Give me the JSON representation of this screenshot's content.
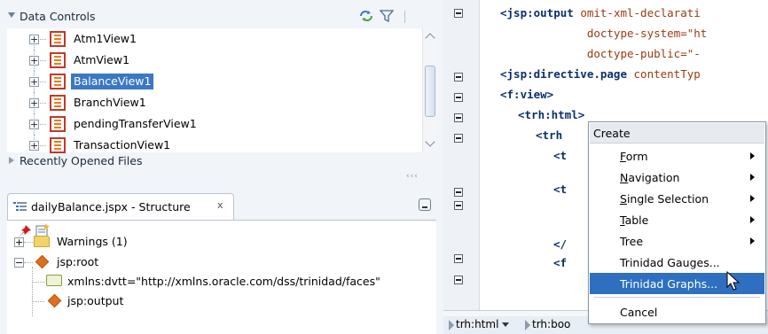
{
  "data_controls": {
    "title": "Data Controls",
    "items": [
      {
        "label": "Atm1View1"
      },
      {
        "label": "AtmView1"
      },
      {
        "label": "BalanceView1",
        "selected": true
      },
      {
        "label": "BranchView1"
      },
      {
        "label": "pendingTransferView1"
      },
      {
        "label": "TransactionView1"
      }
    ],
    "recently_opened": "Recently Opened Files"
  },
  "structure": {
    "tab_label": "dailyBalance.jspx - Structure",
    "close_glyph": "x",
    "nodes": [
      {
        "label": "Warnings (1)"
      },
      {
        "label": "jsp:root"
      },
      {
        "label": "xmlns:dvtt=\"http://xmlns.oracle.com/dss/trinidad/faces\""
      },
      {
        "label": "jsp:output"
      }
    ]
  },
  "editor": {
    "lines": [
      {
        "tag": "<jsp:output",
        "rest": " omit-xml-declarati"
      },
      {
        "tag": "",
        "rest": "             doctype-system=\"ht"
      },
      {
        "tag": "",
        "rest": "             doctype-public=\"-"
      },
      {
        "tag": "<jsp:directive.page",
        "rest": " contentTyp"
      },
      {
        "tag": "<f:view>",
        "rest": ""
      },
      {
        "tag": "<trh:html>",
        "rest": ""
      },
      {
        "tag": "<trh",
        "rest": ""
      },
      {
        "tag": "<t",
        "rest": ""
      },
      {
        "tag": "<t",
        "rest": ""
      },
      {
        "tag": "</",
        "rest": ""
      },
      {
        "tag": "<f",
        "rest": ""
      }
    ],
    "breadcrumbs": [
      "trh:html",
      "trh:boo"
    ]
  },
  "context_menu": {
    "header": "Create",
    "items": [
      {
        "label": "Form",
        "mnemonic": "F",
        "rest": "orm",
        "submenu": true
      },
      {
        "label": "Navigation",
        "mnemonic": "N",
        "rest": "avigation",
        "submenu": true
      },
      {
        "label": "Single Selection",
        "mnemonic": "S",
        "rest": "ingle Selection",
        "submenu": true
      },
      {
        "label": "Table",
        "mnemonic": "T",
        "rest": "able",
        "submenu": true
      },
      {
        "label": "Tree",
        "mnemonic": "",
        "rest": "Tree",
        "submenu": true
      },
      {
        "label": "Trinidad Gauges...",
        "mnemonic": "",
        "rest": "Trinidad Gauges...",
        "submenu": false
      },
      {
        "label": "Trinidad Graphs...",
        "mnemonic": "",
        "rest": "Trinidad Graphs...",
        "submenu": false,
        "highlighted": true
      },
      {
        "label": "Cancel",
        "mnemonic": "",
        "rest": "Cancel",
        "submenu": false
      }
    ]
  },
  "colors": {
    "selection": "#3b77c6",
    "menu_highlight": "#2e6fc0",
    "panel_bg": "#f1f4f8"
  }
}
